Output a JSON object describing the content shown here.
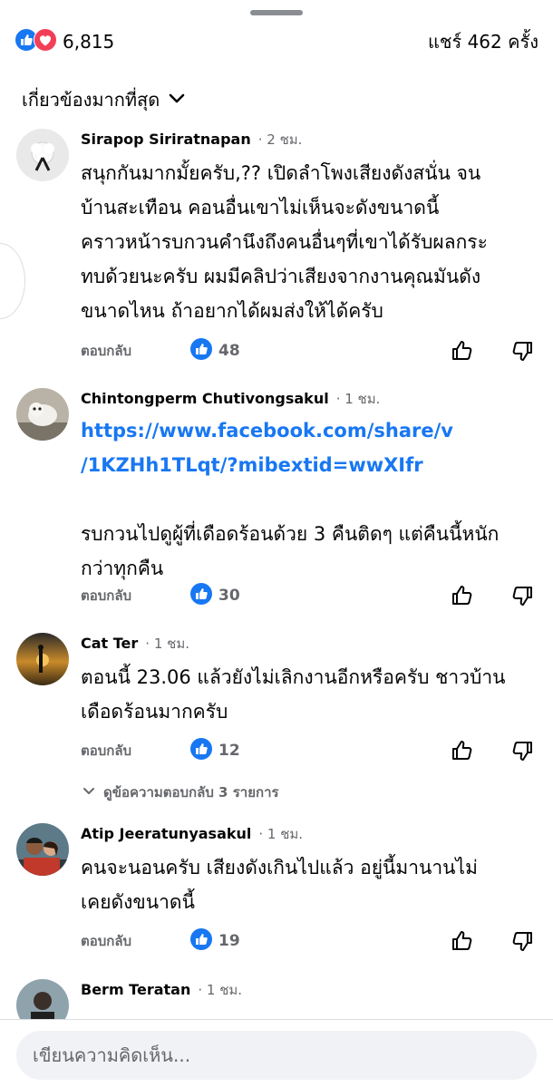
{
  "header": {
    "reaction_count": "6,815",
    "share_text": "แชร์ 462 ครั้ง",
    "icons": [
      "like-icon",
      "love-icon"
    ]
  },
  "sort": {
    "label": "เกี่ยวข้องมากที่สุด",
    "icon": "chevron-down-icon"
  },
  "comments": [
    {
      "name": "Sirapop Siriratnapan",
      "time": "· 2 ชม.",
      "text": "สนุกกันมากมั้ยครับ,?? เปิดลำโพงเสียงดังสนั่น จน\nบ้านสะเทือน คอนอื่นเขาไม่เห็นจะดังขนาดนี้\nคราวหน้ารบกวนคำนึงถึงคนอื่นๆที่เขาได้รับผลกระ\nทบด้วยนะครับ ผมมีคลิปว่าเสียงจากงานคุณมันดัง\nขนาดไหน ถ้าอยากได้ผมส่งให้ได้ครับ",
      "reply": "ตอบกลับ",
      "likes": "48"
    },
    {
      "name": "Chintongperm Chutivongsakul",
      "time": "· 1 ชม.",
      "link": "https://www.facebook.com/share/v\n/1KZHh1TLqt/?mibextid=wwXIfr",
      "text": "รบกวนไปดูผู้ที่เดือดร้อนด้วย 3 คืนติดๆ แต่คืนนี้หนัก\nกว่าทุกคืน",
      "reply": "ตอบกลับ",
      "likes": "30"
    },
    {
      "name": "Cat Ter",
      "time": "· 1 ชม.",
      "text": "ตอนนี้ 23.06 แล้วยังไม่เลิกงานอีกหรือครับ ชาวบ้าน\nเดือดร้อนมากครับ",
      "reply": "ตอบกลับ",
      "likes": "12",
      "more_replies": "ดูข้อความตอบกลับ 3 รายการ"
    },
    {
      "name": "Atip Jeeratunyasakul",
      "time": "· 1 ชม.",
      "text": "คนจะนอนครับ เสียงดังเกินไปแล้ว อยู่นี้มานานไม่\nเคยดังขนาดนี้",
      "reply": "ตอบกลับ",
      "likes": "19"
    },
    {
      "name": "Berm Teratan",
      "time": "· 1 ชม."
    }
  ],
  "composer": {
    "placeholder": "เขียนความคิดเห็น..."
  },
  "colors": {
    "like_blue": "#1877f2",
    "love_red": "#f33e58",
    "secondary_text": "#65676b",
    "composer_bg": "#f0f2f5"
  }
}
